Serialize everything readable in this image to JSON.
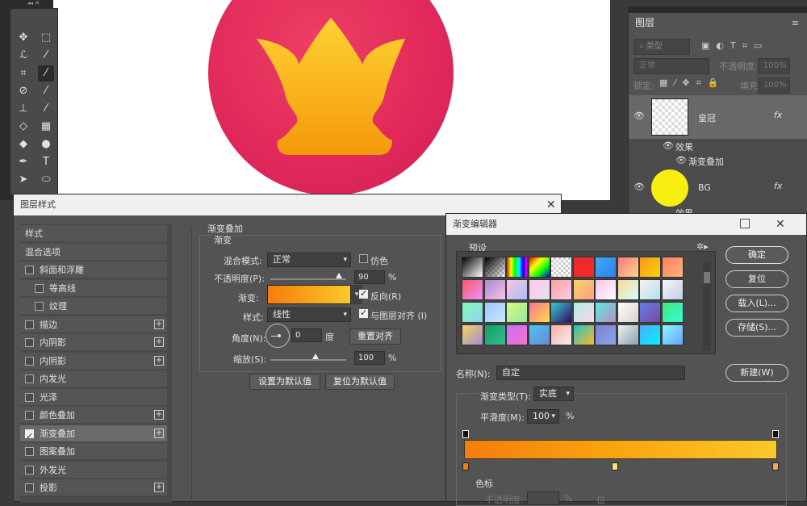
{
  "colors": {
    "accent_red": "#e0285a",
    "crown_orange": "#f9a70e",
    "bg_yellow": "#f8ee10"
  },
  "layers_panel": {
    "tab": "图层",
    "filter_placeholder": "类型",
    "blend_mode": "正常",
    "opacity_label": "不透明度:",
    "opacity_value": "100%",
    "lock_label": "锁定:",
    "fill_label": "填充:",
    "fill_value": "100%",
    "layers": [
      {
        "name": "皇冠",
        "fx": "fx",
        "effects_label": "效果",
        "effect": "渐变叠加"
      },
      {
        "name": "BG",
        "fx": "fx",
        "effects_label": "效果"
      }
    ]
  },
  "layer_style": {
    "title": "图层样式",
    "list": [
      {
        "label": "样式",
        "checkbox": false,
        "plus": false,
        "header": true
      },
      {
        "label": "混合选项",
        "checkbox": false,
        "plus": false,
        "header": true
      },
      {
        "label": "斜面和浮雕",
        "checkbox": true,
        "checked": false,
        "plus": false
      },
      {
        "label": "等高线",
        "checkbox": true,
        "checked": false,
        "plus": false,
        "indent": true
      },
      {
        "label": "纹理",
        "checkbox": true,
        "checked": false,
        "plus": false,
        "indent": true
      },
      {
        "label": "描边",
        "checkbox": true,
        "checked": false,
        "plus": true
      },
      {
        "label": "内阴影",
        "checkbox": true,
        "checked": false,
        "plus": true
      },
      {
        "label": "内阴影",
        "checkbox": true,
        "checked": false,
        "plus": true
      },
      {
        "label": "内发光",
        "checkbox": true,
        "checked": false,
        "plus": false
      },
      {
        "label": "光泽",
        "checkbox": true,
        "checked": false,
        "plus": false
      },
      {
        "label": "颜色叠加",
        "checkbox": true,
        "checked": false,
        "plus": true
      },
      {
        "label": "渐变叠加",
        "checkbox": true,
        "checked": true,
        "plus": true,
        "selected": true
      },
      {
        "label": "图案叠加",
        "checkbox": true,
        "checked": false,
        "plus": false
      },
      {
        "label": "外发光",
        "checkbox": true,
        "checked": false,
        "plus": false
      },
      {
        "label": "投影",
        "checkbox": true,
        "checked": false,
        "plus": true
      }
    ],
    "section_title": "渐变叠加",
    "group_title": "渐变",
    "blend_label": "混合模式:",
    "blend_value": "正常",
    "dither_label": "仿色",
    "opacity_label": "不透明度(P):",
    "opacity_value": "90",
    "opacity_level": 90,
    "pct": "%",
    "gradient_label": "渐变:",
    "reverse_label": "反向(R)",
    "style_label": "样式:",
    "style_value": "线性",
    "align_label": "与图层对齐 (I)",
    "angle_label": "角度(N):",
    "angle_value": "0",
    "degree": "度",
    "reset_align": "重置对齐",
    "scale_label": "缩放(S):",
    "scale_value": "100",
    "scale_level": 100,
    "set_default": "设置为默认值",
    "reset_default": "复位为默认值"
  },
  "gradient_editor": {
    "title": "渐变编辑器",
    "presets_label": "预设",
    "name_label": "名称(N):",
    "name_value": "自定",
    "new_button": "新建(W)",
    "ok_button": "确定",
    "reset_button": "复位",
    "load_button": "载入(L)...",
    "save_button": "存储(S)...",
    "type_label": "渐变类型(T):",
    "type_value": "实底",
    "smooth_label": "平滑度(M):",
    "smooth_value": "100",
    "pct": "%",
    "stops_label": "色标",
    "stop_opacity_label": "不透明度:",
    "stop_location_label": "%",
    "stop_delete": "位"
  }
}
